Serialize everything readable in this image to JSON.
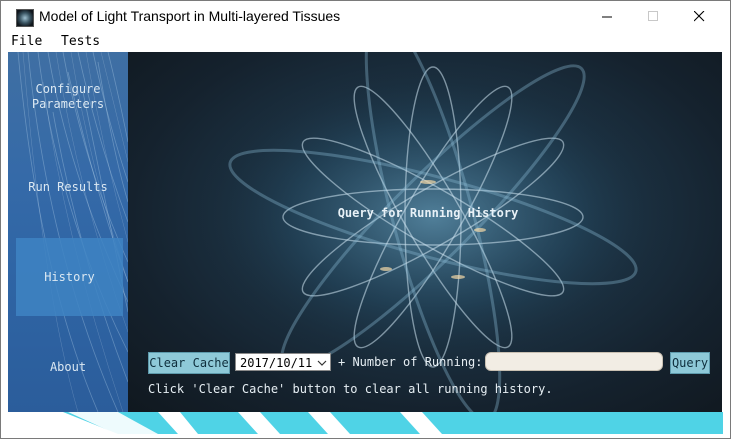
{
  "window": {
    "title": "Model of Light Transport in Multi-layered Tissues",
    "icons": {
      "app": "app-icon",
      "minimize": "minimize-icon",
      "maximize": "maximize-icon",
      "close": "close-icon"
    }
  },
  "menu": {
    "items": [
      {
        "label": "File"
      },
      {
        "label": "Tests"
      }
    ]
  },
  "sidebar": {
    "items": [
      {
        "label": "Configure Parameters",
        "active": false
      },
      {
        "label": "Run Results",
        "active": false
      },
      {
        "label": "History",
        "active": true
      },
      {
        "label": "About",
        "active": false
      }
    ]
  },
  "main": {
    "heading": "Query for Running History",
    "clear_cache_label": "Clear Cache",
    "date_value": "2017/10/11",
    "running_label": "+ Number of Running:",
    "running_value": "",
    "query_label": "Query",
    "hint": "Click 'Clear Cache' button to clear all running history."
  },
  "colors": {
    "sidebar_bg": "#2f65a5",
    "sidebar_active": "#3e84c3",
    "button_bg": "#8ec9d8",
    "footer_accent": "#4fd3e6",
    "content_bg": "#15222e"
  }
}
